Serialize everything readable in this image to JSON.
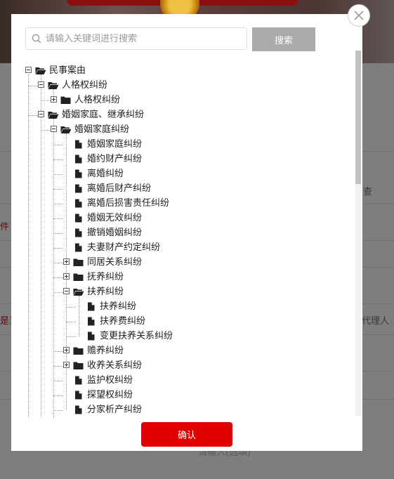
{
  "background": {
    "text_case": "件",
    "text_check": "查",
    "text_party": "是当",
    "text_agent": "代理人",
    "text_bottom": "请输入(选填)"
  },
  "search": {
    "placeholder": "请输入关键词进行搜索",
    "value": "",
    "button_label": "搜索"
  },
  "tree": [
    {
      "label": "民事案由",
      "depth": 0,
      "type": "folder-open",
      "toggle": "minus"
    },
    {
      "label": "人格权纠纷",
      "depth": 1,
      "type": "folder-open",
      "toggle": "minus"
    },
    {
      "label": "人格权纠纷",
      "depth": 2,
      "type": "folder",
      "toggle": "plus"
    },
    {
      "label": "婚姻家庭、继承纠纷",
      "depth": 1,
      "type": "folder-open",
      "toggle": "minus"
    },
    {
      "label": "婚姻家庭纠纷",
      "depth": 2,
      "type": "folder-open",
      "toggle": "minus"
    },
    {
      "label": "婚姻家庭纠纷",
      "depth": 3,
      "type": "file",
      "toggle": "none"
    },
    {
      "label": "婚约财产纠纷",
      "depth": 3,
      "type": "file",
      "toggle": "none"
    },
    {
      "label": "离婚纠纷",
      "depth": 3,
      "type": "file",
      "toggle": "none"
    },
    {
      "label": "离婚后财产纠纷",
      "depth": 3,
      "type": "file",
      "toggle": "none"
    },
    {
      "label": "离婚后损害责任纠纷",
      "depth": 3,
      "type": "file",
      "toggle": "none"
    },
    {
      "label": "婚姻无效纠纷",
      "depth": 3,
      "type": "file",
      "toggle": "none"
    },
    {
      "label": "撤销婚姻纠纷",
      "depth": 3,
      "type": "file",
      "toggle": "none"
    },
    {
      "label": "夫妻财产约定纠纷",
      "depth": 3,
      "type": "file",
      "toggle": "none"
    },
    {
      "label": "同居关系纠纷",
      "depth": 3,
      "type": "folder",
      "toggle": "plus"
    },
    {
      "label": "抚养纠纷",
      "depth": 3,
      "type": "folder",
      "toggle": "plus"
    },
    {
      "label": "扶养纠纷",
      "depth": 3,
      "type": "folder-open",
      "toggle": "minus"
    },
    {
      "label": "扶养纠纷",
      "depth": 4,
      "type": "file",
      "toggle": "none"
    },
    {
      "label": "扶养费纠纷",
      "depth": 4,
      "type": "file",
      "toggle": "none"
    },
    {
      "label": "变更扶养关系纠纷",
      "depth": 4,
      "type": "file",
      "toggle": "none"
    },
    {
      "label": "赡养纠纷",
      "depth": 3,
      "type": "folder",
      "toggle": "plus"
    },
    {
      "label": "收养关系纠纷",
      "depth": 3,
      "type": "folder",
      "toggle": "plus"
    },
    {
      "label": "监护权纠纷",
      "depth": 3,
      "type": "file",
      "toggle": "none"
    },
    {
      "label": "探望权纠纷",
      "depth": 3,
      "type": "file",
      "toggle": "none"
    },
    {
      "label": "分家析产纠纷",
      "depth": 3,
      "type": "file",
      "toggle": "none"
    }
  ],
  "confirm_label": "确认",
  "colors": {
    "accent": "#e00000",
    "search_button": "#aaaaaa"
  },
  "icons": {
    "close": "close-icon",
    "search": "search-icon",
    "folder": "folder-icon",
    "folder_open": "folder-open-icon",
    "file": "file-icon"
  }
}
